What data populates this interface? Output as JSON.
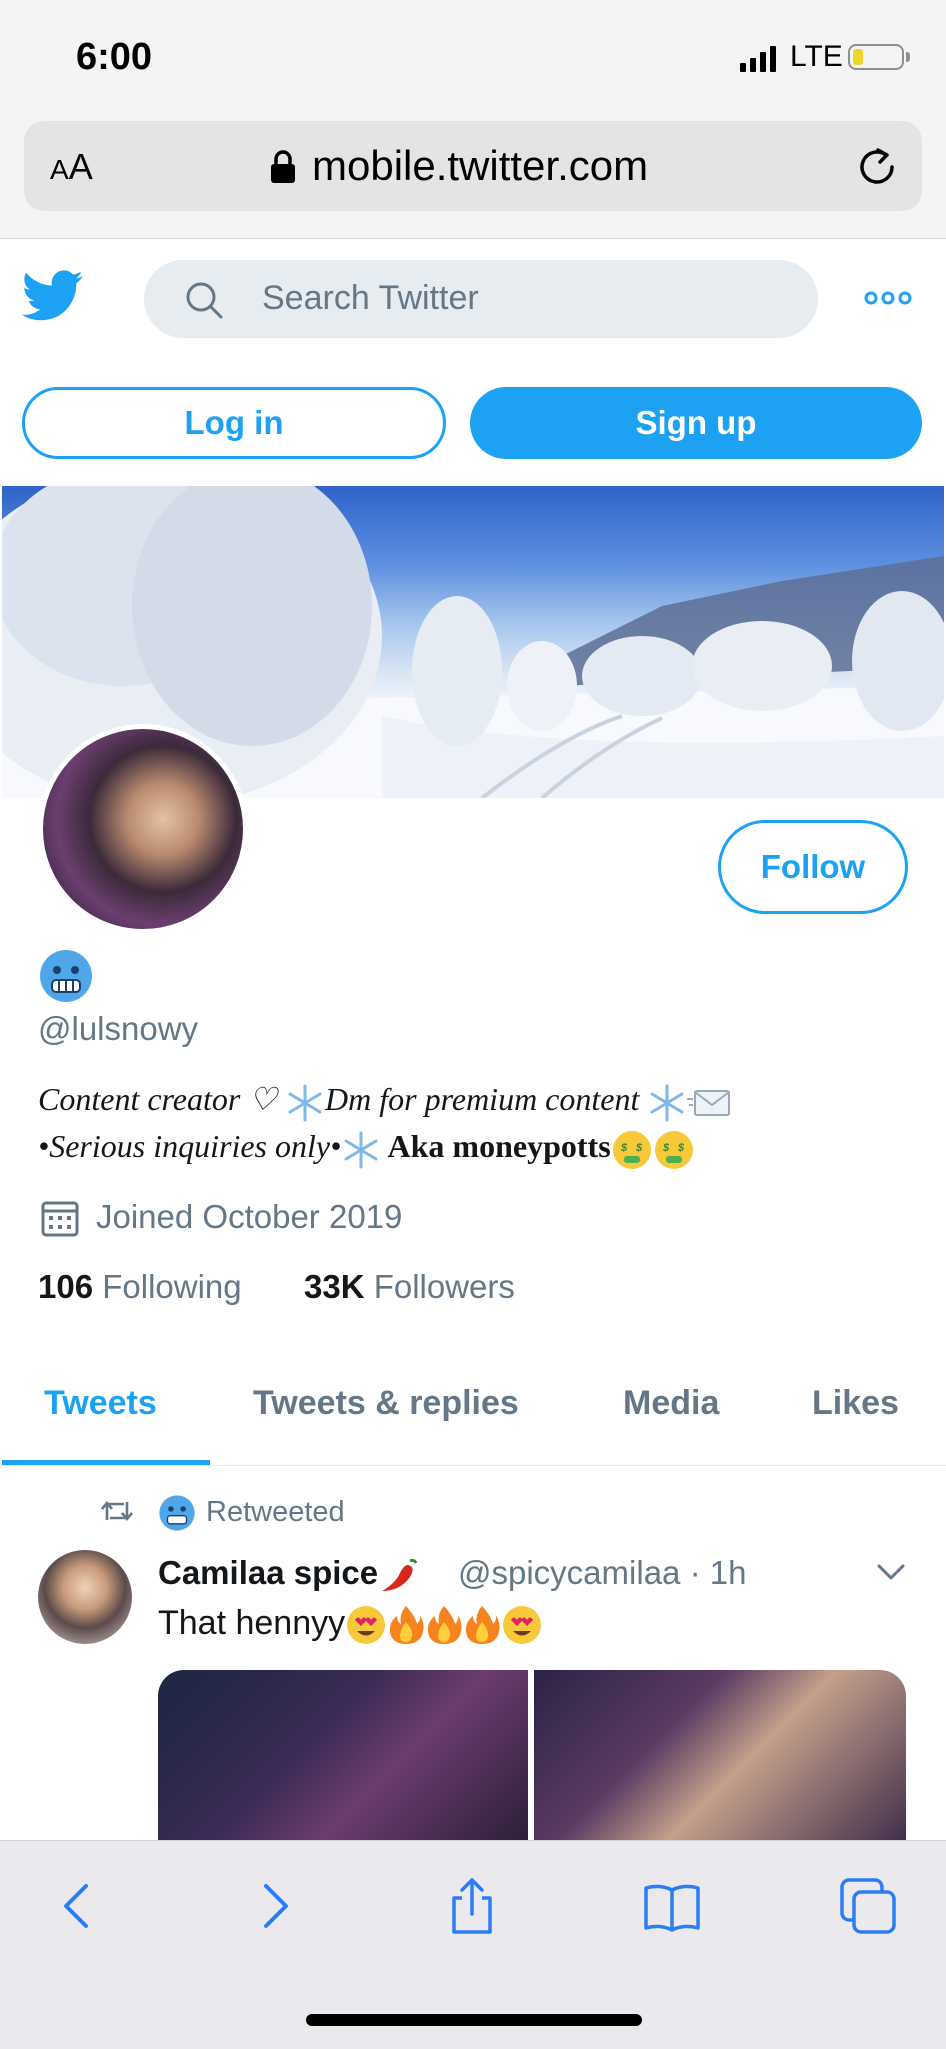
{
  "status_bar": {
    "time": "6:00",
    "network": "LTE",
    "battery_level": 0.2
  },
  "safari": {
    "aa_label_small": "A",
    "aa_label_large": "A",
    "url": "mobile.twitter.com"
  },
  "twitter_header": {
    "search_placeholder": "Search Twitter",
    "login_label": "Log in",
    "signup_label": "Sign up"
  },
  "profile": {
    "follow_label": "Follow",
    "handle": "@lulsnowy",
    "bio_line1": "Content creator ♡ ",
    "bio_line1b": "Dm  for  premium  content ",
    "bio_line2a": "•Serious inquiries only•",
    "bio_line2b": " Aka moneypotts",
    "joined": "Joined October 2019",
    "following_count": "106",
    "following_label": "Following",
    "followers_count": "33K",
    "followers_label": "Followers"
  },
  "tabs": [
    {
      "label": "Tweets",
      "active": true
    },
    {
      "label": "Tweets & replies",
      "active": false
    },
    {
      "label": "Media",
      "active": false
    },
    {
      "label": "Likes",
      "active": false
    }
  ],
  "tweet": {
    "retweet_label": "Retweeted",
    "author_name": "Camilaa spice",
    "author_handle": "@spicycamilaa",
    "separator": "·",
    "time_ago": "1h",
    "text": "That hennyy"
  },
  "colors": {
    "twitter_blue": "#1da1f2",
    "secondary_text": "#657786",
    "primary_text": "#14171a",
    "safari_blue": "#2a7cf7"
  }
}
